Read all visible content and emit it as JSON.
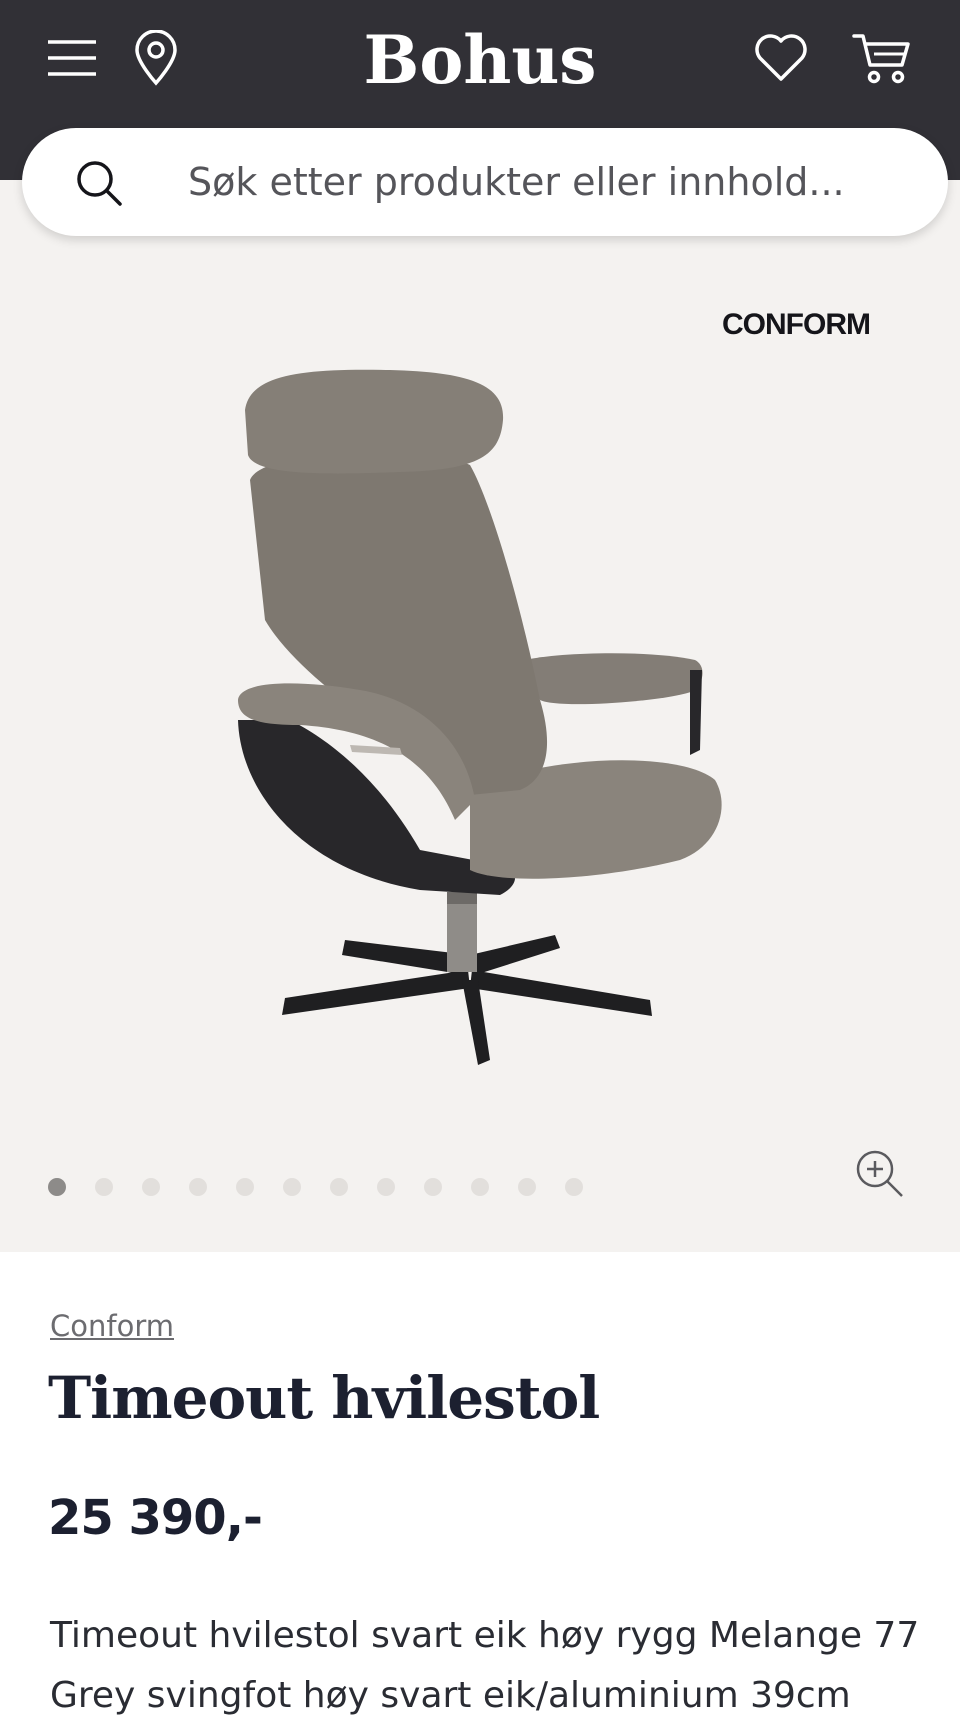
{
  "header": {
    "logo": "Bohus",
    "menu_icon": "hamburger-menu-icon",
    "location_icon": "map-pin-icon",
    "favorite_icon": "heart-icon",
    "cart_icon": "shopping-cart-icon",
    "background_color": "#313036"
  },
  "search": {
    "placeholder": "Søk etter produkter eller innhold...",
    "icon": "search-icon"
  },
  "gallery": {
    "brand_logo": "CONFORM",
    "image_count": 12,
    "active_index": 0,
    "zoom_icon": "zoom-in-icon",
    "background_color": "#f4f2f0"
  },
  "product": {
    "brand": "Conform",
    "title": "Timeout hvilestol",
    "price": "25 390,-",
    "description": "Timeout hvilestol svart eik høy rygg Melange 77 Grey svingfot høy svart eik/aluminium 39cm"
  }
}
